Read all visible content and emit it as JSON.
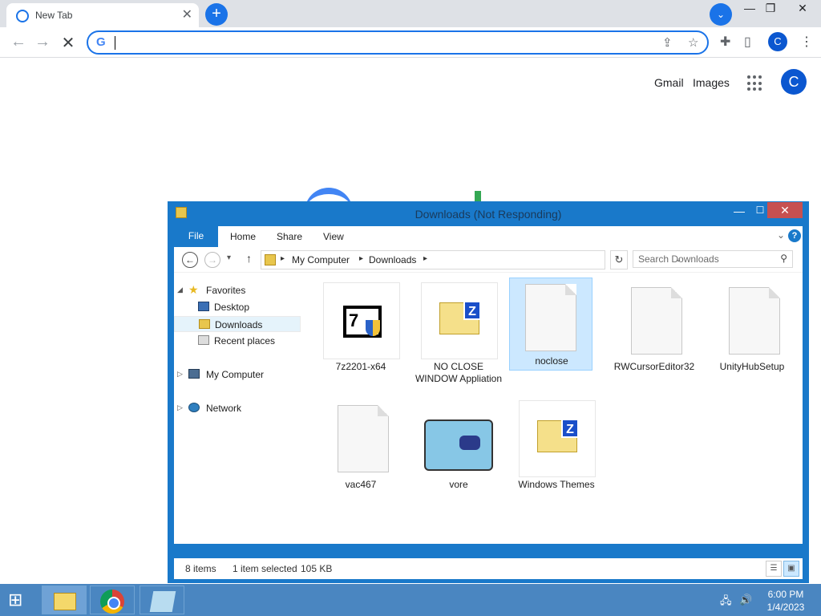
{
  "browser": {
    "tab_title": "New Tab",
    "tab_close": "✕",
    "new_tab": "+",
    "tab_search": "⌄",
    "win_min": "—",
    "win_max": "❐",
    "win_close": "✕",
    "omnibox_value": "",
    "g_logo": "G",
    "profile_initial": "C"
  },
  "ntp": {
    "gmail": "Gmail",
    "images": "Images",
    "profile_initial": "C"
  },
  "explorer": {
    "title": "Downloads (Not Responding)",
    "min": "—",
    "max": "☐",
    "close": "✕",
    "ribbon": {
      "file": "File",
      "home": "Home",
      "share": "Share",
      "view": "View",
      "chevron": "⌄",
      "help": "?"
    },
    "address": {
      "back": "←",
      "fwd": "→",
      "recent": "▾",
      "up": "↑",
      "segment1": "My Computer",
      "segment2": "Downloads",
      "sep": "▸",
      "dropdown": "⌄",
      "refresh": "↻"
    },
    "search_placeholder": "Search Downloads",
    "search_icon": "⚲",
    "nav": [
      {
        "label": "Favorites",
        "icon": "star-icon"
      },
      {
        "label": "Desktop",
        "icon": "desktop-icon"
      },
      {
        "label": "Downloads",
        "icon": "downloads-icon"
      },
      {
        "label": "Recent places",
        "icon": "recent-places-icon"
      },
      {
        "label": "My Computer",
        "icon": "computer-icon"
      },
      {
        "label": "Network",
        "icon": "network-icon"
      }
    ],
    "files": [
      {
        "name": "7z2201-x64",
        "icon": "7zip-installer-icon"
      },
      {
        "name": "NO CLOSE WINDOW Appliation",
        "icon": "zip-folder-icon"
      },
      {
        "name": "noclose",
        "icon": "blank-file-icon"
      },
      {
        "name": "RWCursorEditor32",
        "icon": "blank-file-icon"
      },
      {
        "name": "UnityHubSetup",
        "icon": "blank-file-icon"
      },
      {
        "name": "vac467",
        "icon": "blank-file-icon"
      },
      {
        "name": "vore",
        "icon": "image-thumbnail-icon"
      },
      {
        "name": "Windows Themes",
        "icon": "zip-folder-icon"
      }
    ],
    "status": {
      "items": "8 items",
      "selected": "1 item selected",
      "size": "105 KB"
    }
  },
  "taskbar": {
    "start": "⊞",
    "time": "6:00 PM",
    "date": "1/4/2023"
  }
}
